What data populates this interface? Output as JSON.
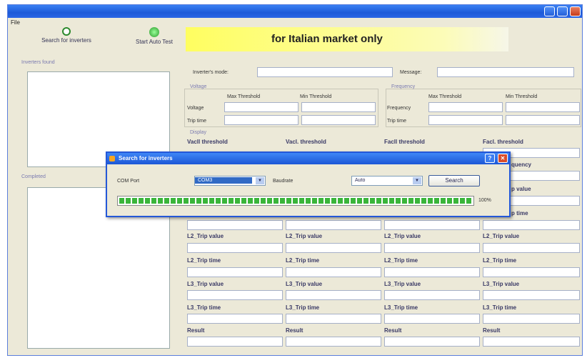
{
  "menu": {
    "file": "File"
  },
  "toolbar": {
    "search_label": "Search for inverters",
    "autotest_label": "Start Auto Test"
  },
  "banner": "for Italian market only",
  "left": {
    "found_label": "Inverters found",
    "completed_label": "Completed"
  },
  "top": {
    "mode_label": "Inverter's mode:",
    "message_label": "Message:"
  },
  "voltage": {
    "group_label": "Voltage",
    "col1": "Max Threshold",
    "col2": "Min Threshold",
    "row1": "Voltage",
    "row2": "Trip time"
  },
  "frequency": {
    "group_label": "Frequency",
    "col1": "Max Threshold",
    "col2": "Min Threshold",
    "row1": "Frequency",
    "row2": "Trip time"
  },
  "display": {
    "group_label": "Display",
    "headers": [
      "Vacll threshold",
      "Vacl. threshold",
      "Facll threshold",
      "Facl. threshold"
    ],
    "rows": [
      {
        "labels": [
          "L2_Trip value",
          "L2_Trip value",
          "L2_Trip value",
          "L2_Trip value"
        ]
      },
      {
        "labels": [
          "L2_Trip time",
          "L2_Trip time",
          "L2_Trip time",
          "L2_Trip time"
        ]
      },
      {
        "labels": [
          "L3_Trip value",
          "L3_Trip value",
          "L3_Trip value",
          "L3_Trip value"
        ]
      },
      {
        "labels": [
          "L3_Trip time",
          "L3_Trip time",
          "L3_Trip time",
          "L3_Trip time"
        ]
      },
      {
        "labels": [
          "Result",
          "Result",
          "Result",
          "Result"
        ]
      }
    ],
    "partial_right": [
      "quency",
      "p value",
      "p time"
    ]
  },
  "dialog": {
    "title": "Search for inverters",
    "com_label": "COM Port",
    "com_value": "COM3",
    "baud_label": "Baudrate",
    "baud_value": "Auto",
    "search_button": "Search",
    "progress_percent": 100,
    "progress_text": "100%"
  },
  "colors": {
    "titlebar": "#1d5ad8",
    "progress": "#3ab53a",
    "banner": "#fffe60"
  }
}
